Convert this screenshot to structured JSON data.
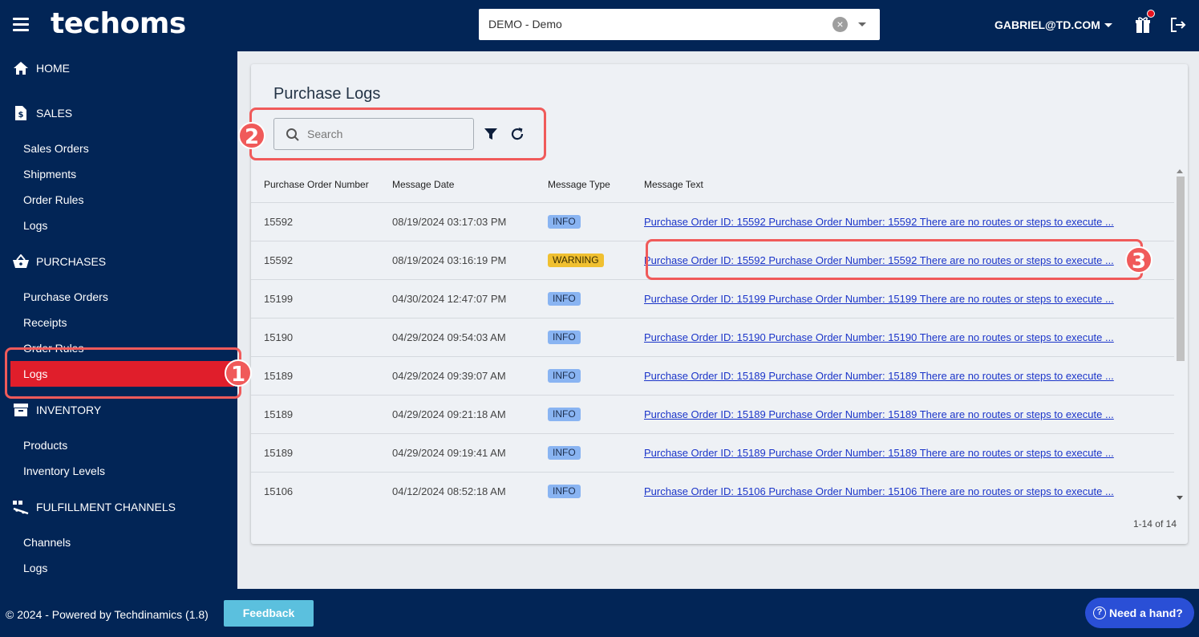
{
  "header": {
    "logo": "techoms",
    "tenant": "DEMO - Demo",
    "user": "GABRIEL@TD.COM"
  },
  "sidebar": {
    "sections": [
      {
        "label": "HOME",
        "icon": "home-icon"
      },
      {
        "label": "SALES",
        "icon": "document-dollar-icon",
        "items": [
          "Sales Orders",
          "Shipments",
          "Order Rules",
          "Logs"
        ]
      },
      {
        "label": "PURCHASES",
        "icon": "basket-icon",
        "items": [
          "Purchase Orders",
          "Receipts",
          "Order Rules",
          "Logs"
        ],
        "active": "Logs"
      },
      {
        "label": "INVENTORY",
        "icon": "archive-icon",
        "items": [
          "Products",
          "Inventory Levels"
        ]
      },
      {
        "label": "FULFILLMENT CHANNELS",
        "icon": "conveyor-icon",
        "items": [
          "Channels",
          "Logs"
        ]
      }
    ]
  },
  "main": {
    "title": "Purchase Logs",
    "search_placeholder": "Search",
    "columns": [
      "Purchase Order Number",
      "Message Date",
      "Message Type",
      "Message Text"
    ],
    "rows": [
      {
        "po": "15592",
        "date": "08/19/2024 03:17:03 PM",
        "type": "INFO",
        "text": "Purchase Order ID: 15592 Purchase Order Number: 15592 There are no routes or steps to execute ..."
      },
      {
        "po": "15592",
        "date": "08/19/2024 03:16:19 PM",
        "type": "WARNING",
        "text": "Purchase Order ID: 15592 Purchase Order Number: 15592 There are no routes or steps to execute ..."
      },
      {
        "po": "15199",
        "date": "04/30/2024 12:47:07 PM",
        "type": "INFO",
        "text": "Purchase Order ID: 15199 Purchase Order Number: 15199 There are no routes or steps to execute ..."
      },
      {
        "po": "15190",
        "date": "04/29/2024 09:54:03 AM",
        "type": "INFO",
        "text": "Purchase Order ID: 15190 Purchase Order Number: 15190 There are no routes or steps to execute ..."
      },
      {
        "po": "15189",
        "date": "04/29/2024 09:39:07 AM",
        "type": "INFO",
        "text": "Purchase Order ID: 15189 Purchase Order Number: 15189 There are no routes or steps to execute ..."
      },
      {
        "po": "15189",
        "date": "04/29/2024 09:21:18 AM",
        "type": "INFO",
        "text": "Purchase Order ID: 15189 Purchase Order Number: 15189 There are no routes or steps to execute ..."
      },
      {
        "po": "15189",
        "date": "04/29/2024 09:19:41 AM",
        "type": "INFO",
        "text": "Purchase Order ID: 15189 Purchase Order Number: 15189 There are no routes or steps to execute ..."
      },
      {
        "po": "15106",
        "date": "04/12/2024 08:52:18 AM",
        "type": "INFO",
        "text": "Purchase Order ID: 15106 Purchase Order Number: 15106 There are no routes or steps to execute ..."
      }
    ],
    "pagination": "1-14 of 14"
  },
  "footer": {
    "copyright": "© 2024 - Powered by Techdinamics (1.8)",
    "feedback": "Feedback",
    "help": "Need a hand?"
  },
  "annotations": [
    "1",
    "2",
    "3"
  ],
  "colors": {
    "navy": "#022556",
    "active_red": "#e01e2b",
    "annotation_red": "#f05a5a",
    "info_badge": "#89b4f2",
    "warning_badge": "#f0c030",
    "link_blue": "#1b35c9"
  }
}
